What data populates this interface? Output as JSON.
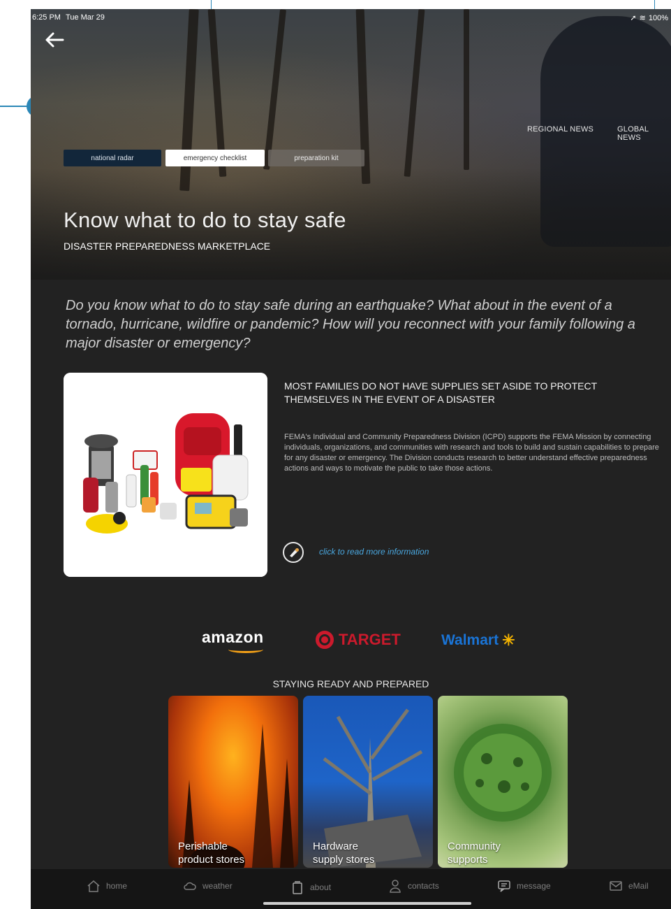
{
  "status_bar": {
    "time": "6:25 PM",
    "date": "Tue Mar 29",
    "battery": "100%"
  },
  "header": {
    "back_icon": "arrow-left-icon",
    "news_links": [
      "REGIONAL NEWS",
      "GLOBAL NEWS"
    ],
    "tabs": [
      {
        "label": "national radar",
        "state": "active"
      },
      {
        "label": "emergency checklist",
        "state": "selected"
      },
      {
        "label": "preparation kit",
        "state": "inactive"
      }
    ],
    "title": "Know what to do to stay safe",
    "subtitle": "DISASTER PREPAREDNESS MARKETPLACE"
  },
  "intro_text": "Do you know what to do to stay safe during an earthquake? What about in the event of a tornado, hurricane, wildfire or pandemic? How will you reconnect with your family following a major disaster or emergency?",
  "info": {
    "heading": "MOST FAMILIES DO NOT HAVE SUPPLIES SET ASIDE TO PROTECT THEMSELVES IN THE EVENT OF A DISASTER",
    "body": "FEMA's Individual and Community Preparedness Division (ICPD) supports the FEMA Mission by connecting individuals, organizations, and communities with research and tools to build and sustain capabilities to prepare for any disaster or emergency. The Division conducts research to better understand effective preparedness actions and ways to motivate the public to take those actions.",
    "read_more": "click to read more information"
  },
  "brands": {
    "amazon": "amazon",
    "target": "TARGET",
    "walmart": "Walmart"
  },
  "section_title": "STAYING READY AND PREPARED",
  "categories": [
    {
      "line1": "Perishable",
      "line2": "product stores"
    },
    {
      "line1": "Hardware",
      "line2": "supply stores"
    },
    {
      "line1": "Community",
      "line2": "supports"
    }
  ],
  "nav": [
    {
      "label": "home",
      "icon": "home-icon"
    },
    {
      "label": "weather",
      "icon": "cloud-icon"
    },
    {
      "label": "about",
      "icon": "document-icon"
    },
    {
      "label": "contacts",
      "icon": "person-icon"
    },
    {
      "label": "message",
      "icon": "chat-icon"
    },
    {
      "label": "eMail",
      "icon": "mail-icon"
    }
  ],
  "colors": {
    "accent_blue": "#2b87b7",
    "background": "#222222",
    "link": "#4aa8e0",
    "tab_active": "#12263a"
  }
}
